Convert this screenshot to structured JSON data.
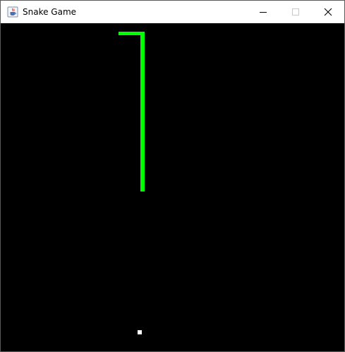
{
  "window": {
    "title": "Snake Game",
    "icon": "java-cup-icon",
    "controls": [
      "minimize-icon",
      "maximize-icon",
      "close-icon"
    ]
  },
  "game": {
    "background_color": "#000000",
    "snake_color": "#00ff00",
    "food_color": "#ffffff"
  }
}
